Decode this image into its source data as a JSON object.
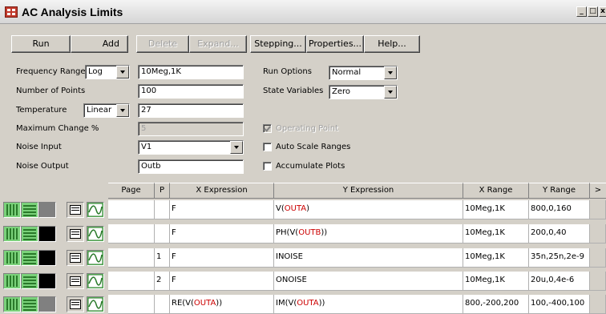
{
  "window": {
    "title": "AC Analysis Limits"
  },
  "toolbar": {
    "run": "Run",
    "add": "Add",
    "delete": "Delete",
    "expand": "Expand...",
    "stepping": "Stepping...",
    "properties": "Properties...",
    "help": "Help..."
  },
  "form": {
    "frequency_range_label": "Frequency Range",
    "frequency_range_mode": "Log",
    "frequency_range_value": "10Meg,1K",
    "number_of_points_label": "Number of Points",
    "number_of_points_value": "100",
    "temperature_label": "Temperature",
    "temperature_mode": "Linear",
    "temperature_value": "27",
    "max_change_label": "Maximum Change %",
    "max_change_value": "5",
    "noise_input_label": "Noise Input",
    "noise_input_value": "V1",
    "noise_output_label": "Noise Output",
    "noise_output_value": "Outb",
    "run_options_label": "Run Options",
    "run_options_value": "Normal",
    "state_variables_label": "State Variables",
    "state_variables_value": "Zero",
    "operating_point_label": "Operating Point",
    "operating_point_checked": true,
    "auto_scale_label": "Auto Scale Ranges",
    "auto_scale_checked": false,
    "accumulate_label": "Accumulate Plots",
    "accumulate_checked": false
  },
  "grid": {
    "headers": {
      "page": "Page",
      "p": "P",
      "x": "X Expression",
      "y": "Y Expression",
      "xrange": "X Range",
      "yrange": "Y Range",
      "more": ">"
    },
    "rows": [
      {
        "page": "",
        "p": "",
        "x": "F",
        "y_pre": "V(",
        "y_red": "OUTA",
        "y_post": ")",
        "xrange": "10Meg,1K",
        "yrange": "800,0,160",
        "color": "#808080"
      },
      {
        "page": "",
        "p": "",
        "x": "F",
        "y_pre": "PH(V(",
        "y_red": "OUTB",
        "y_post": "))",
        "xrange": "10Meg,1K",
        "yrange": "200,0,40",
        "color": "#000000"
      },
      {
        "page": "",
        "p": "1",
        "x": "F",
        "y_pre": "",
        "y_red": "",
        "y_post": "INOISE",
        "xrange": "10Meg,1K",
        "yrange": "35n,25n,2e-9",
        "color": "#000000"
      },
      {
        "page": "",
        "p": "2",
        "x": "F",
        "y_pre": "",
        "y_red": "",
        "y_post": "ONOISE",
        "xrange": "10Meg,1K",
        "yrange": "20u,0,4e-6",
        "color": "#000000"
      },
      {
        "page": "",
        "p": "",
        "x_pre": "RE(V(",
        "x_red": "OUTA",
        "x_post": "))",
        "y_pre": "IM(V(",
        "y_red": "OUTA",
        "y_post": "))",
        "xrange": "800,-200,200",
        "yrange": "100,-400,100",
        "color": "#808080"
      }
    ]
  }
}
